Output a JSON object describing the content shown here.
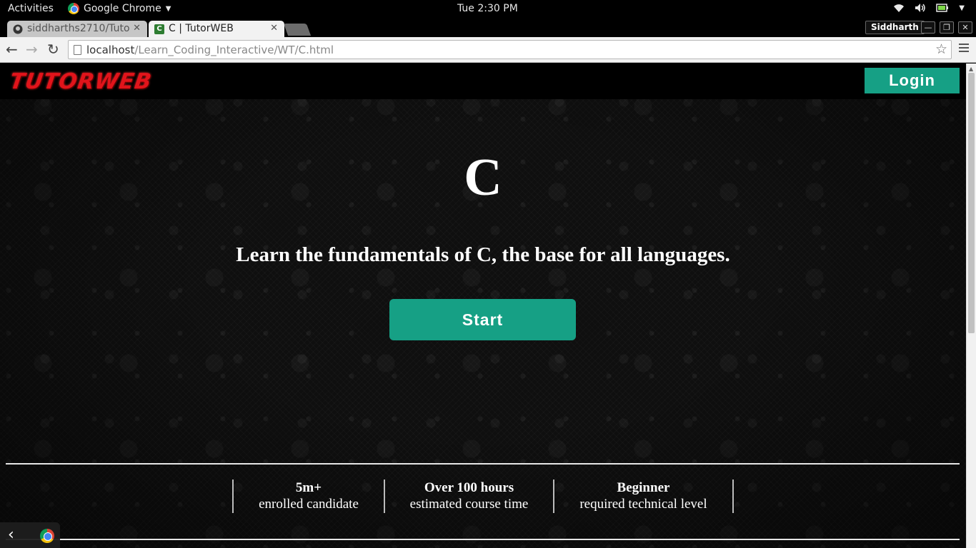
{
  "system_bar": {
    "activities": "Activities",
    "app_name": "Google Chrome",
    "clock": "Tue  2:30 PM"
  },
  "tabs": [
    {
      "label": "siddharths2710/Tuto",
      "favicon": "github-icon"
    },
    {
      "label": "C | TutorWEB",
      "favicon": "C"
    }
  ],
  "profile": "Siddharth",
  "address_bar": {
    "host": "localhost",
    "path": "/Learn_Coding_Interactive/WT/C.html"
  },
  "site": {
    "logo": "TUTORWEB",
    "login_label": "Login",
    "hero_title": "C",
    "hero_subtitle": "Learn the fundamentals of C, the base for all languages.",
    "start_label": "Start",
    "stats": [
      {
        "value": "5m+",
        "label": "enrolled candidate"
      },
      {
        "value": "Over 100 hours",
        "label": "estimated course time"
      },
      {
        "value": "Beginner",
        "label": "required technical level"
      }
    ]
  },
  "colors": {
    "accent": "#16a085",
    "logo_red": "#e1141b"
  }
}
